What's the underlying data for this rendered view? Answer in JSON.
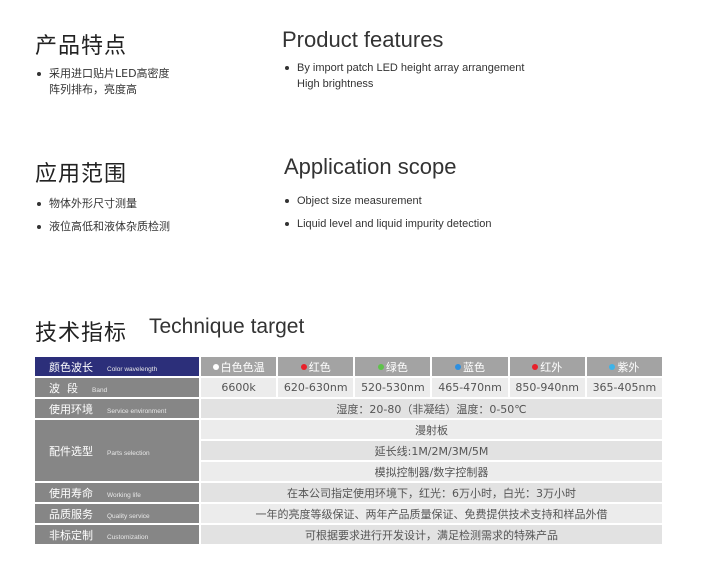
{
  "features": {
    "title_cn": "产品特点",
    "title_en": "Product features",
    "items_cn": [
      {
        "line1": "采用进口贴片LED高密度",
        "line2": "阵列排布，亮度高"
      }
    ],
    "items_en": [
      {
        "line1": "By import patch LED height array arrangement",
        "line2": "High brightness"
      }
    ]
  },
  "application": {
    "title_cn": "应用范围",
    "title_en": "Application scope",
    "items_cn": [
      "物体外形尺寸测量",
      "液位高低和液体杂质检测"
    ],
    "items_en": [
      "Object size measurement",
      "Liquid level and liquid impurity detection"
    ]
  },
  "technique": {
    "title_cn": "技术指标",
    "title_en": "Technique target"
  },
  "table": {
    "header": {
      "label_cn": "颜色波长",
      "label_en": "Color wavelength",
      "colors": [
        {
          "name": "白色色温",
          "dot": "#ffffff"
        },
        {
          "name": "红色",
          "dot": "#e8202a"
        },
        {
          "name": "绿色",
          "dot": "#5ec24a"
        },
        {
          "name": "蓝色",
          "dot": "#2d8fe0"
        },
        {
          "name": "红外",
          "dot": "#e8202a"
        },
        {
          "name": "紫外",
          "dot": "#3db3e8"
        }
      ]
    },
    "band": {
      "label_cn": "波  段",
      "label_en": "Band",
      "values": [
        "6600k",
        "620-630nm",
        "520-530nm",
        "465-470nm",
        "850-940nm",
        "365-405nm"
      ]
    },
    "environment": {
      "label_cn": "使用环境",
      "label_en": "Service environment",
      "value": "湿度：20-80（非凝结）温度：0-50℃"
    },
    "parts": {
      "label_cn": "配件选型",
      "label_en": "Parts selection",
      "values": [
        "漫射板",
        "延长线:1M/2M/3M/5M",
        "模拟控制器/数字控制器"
      ]
    },
    "life": {
      "label_cn": "使用寿命",
      "label_en": "Working life",
      "value": "在本公司指定使用环境下，红光：6万小时，白光：3万小时"
    },
    "quality": {
      "label_cn": "品质服务",
      "label_en": "Quality service",
      "value": "一年的亮度等级保证、两年产品质量保证、免费提供技术支持和样品外借"
    },
    "custom": {
      "label_cn": "非标定制",
      "label_en": "Customization",
      "value": "可根据要求进行开发设计，满足检测需求的特殊产品"
    }
  }
}
